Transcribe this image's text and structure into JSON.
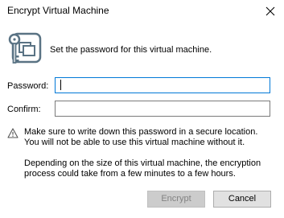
{
  "window": {
    "title": "Encrypt Virtual Machine",
    "close_label": "Close"
  },
  "header": {
    "icon": "vm-lock-icon",
    "text": "Set the password for this virtual machine."
  },
  "form": {
    "password_label": "Password:",
    "password_value": "",
    "confirm_label": "Confirm:",
    "confirm_value": ""
  },
  "notes": {
    "warning_icon": "warning-triangle-icon",
    "warning_text": "Make sure to write down this password in a secure location. You will not be able to use this virtual machine without it.",
    "info_text": "Depending on the size of this virtual machine, the encryption process could take from a few minutes to a few hours."
  },
  "buttons": {
    "encrypt_label": "Encrypt",
    "encrypt_enabled": false,
    "cancel_label": "Cancel"
  },
  "colors": {
    "focus_border": "#0078d7",
    "icon_color": "#5a7384"
  }
}
